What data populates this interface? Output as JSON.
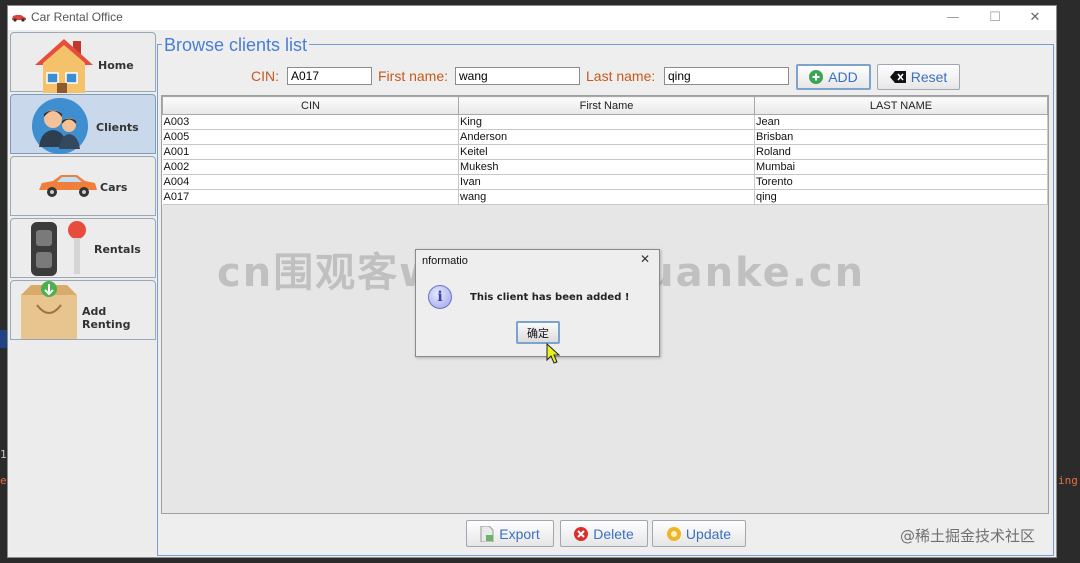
{
  "window": {
    "title": "Car Rental Office"
  },
  "sidebar": {
    "items": [
      {
        "label": "Home",
        "icon": "house-icon"
      },
      {
        "label": "Clients",
        "icon": "people-icon",
        "active": true
      },
      {
        "label": "Cars",
        "icon": "car-icon"
      },
      {
        "label": "Rentals",
        "icon": "car-key-icon"
      },
      {
        "label": "Add Renting",
        "icon": "box-icon"
      }
    ]
  },
  "panel": {
    "title": "Browse clients list"
  },
  "filters": {
    "cin_label": "CIN:",
    "cin_value": "A017",
    "first_label": "First name:",
    "first_value": "wang",
    "last_label": "Last name:",
    "last_value": "qing",
    "add_label": "ADD",
    "reset_label": "Reset"
  },
  "table": {
    "columns": [
      "CIN",
      "First Name",
      "LAST NAME"
    ],
    "rows": [
      [
        "A003",
        "King",
        "Jean"
      ],
      [
        "A005",
        "Anderson",
        "Brisban"
      ],
      [
        "A001",
        "Keitel",
        "Roland"
      ],
      [
        "A002",
        "Mukesh",
        "Mumbai"
      ],
      [
        "A004",
        "Ivan",
        "Torento"
      ],
      [
        "A017",
        "wang",
        "qing"
      ]
    ]
  },
  "actions": {
    "export_label": "Export",
    "delete_label": "Delete",
    "update_label": "Update"
  },
  "dialog": {
    "title": "nformatio",
    "message": "This client has been added !",
    "ok_label": "确定"
  },
  "watermark": "cn围观客www.weiguanke.cn",
  "corner_mark": "@稀土掘金技术社区",
  "background_text": {
    "left_digit": "1",
    "left_char": "e",
    "right_text": "ing"
  },
  "colors": {
    "accent": "#4a7dd6",
    "label_orange": "#c65a1e",
    "active_tab": "#c9d8ea"
  }
}
